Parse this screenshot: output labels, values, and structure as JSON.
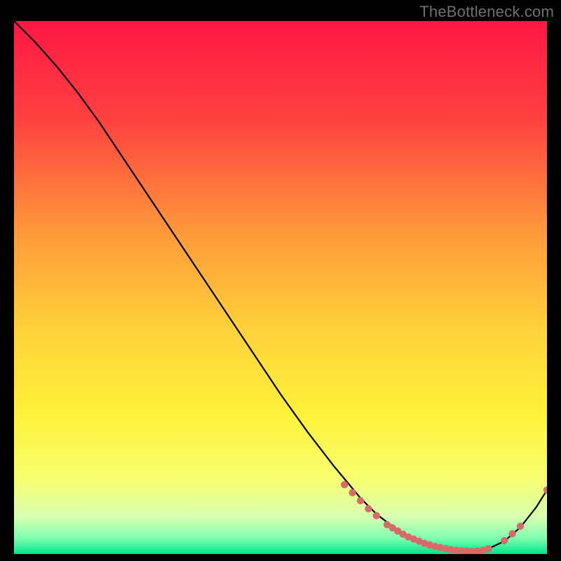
{
  "watermark": "TheBottleneck.com",
  "colors": {
    "curve": "#000000",
    "point_fill": "#d86a6a",
    "gradient_stops": [
      {
        "offset": "0%",
        "color": "#ff1744"
      },
      {
        "offset": "18%",
        "color": "#ff4040"
      },
      {
        "offset": "40%",
        "color": "#ff9a3a"
      },
      {
        "offset": "58%",
        "color": "#ffd23a"
      },
      {
        "offset": "74%",
        "color": "#fff23a"
      },
      {
        "offset": "86%",
        "color": "#f7ff70"
      },
      {
        "offset": "93%",
        "color": "#d8ffb0"
      },
      {
        "offset": "97%",
        "color": "#80ffb0"
      },
      {
        "offset": "100%",
        "color": "#00e58a"
      }
    ]
  },
  "chart_data": {
    "type": "line",
    "title": "",
    "xlabel": "",
    "ylabel": "",
    "xlim": [
      0,
      100
    ],
    "ylim": [
      0,
      100
    ],
    "series": [
      {
        "name": "bottleneck-curve",
        "x": [
          0,
          4,
          8,
          12,
          16,
          20,
          25,
          30,
          35,
          40,
          45,
          50,
          55,
          60,
          65,
          68,
          71,
          74,
          77,
          80,
          83,
          86,
          89,
          92,
          95,
          98,
          100
        ],
        "y": [
          100,
          96,
          91.5,
          86.5,
          81,
          75,
          67.5,
          60,
          52.5,
          45,
          37.5,
          30,
          23,
          16.5,
          10.5,
          7.5,
          5.2,
          3.4,
          2.0,
          1.1,
          0.6,
          0.5,
          1.0,
          2.4,
          5.0,
          8.8,
          12.0
        ]
      }
    ],
    "points": [
      {
        "x": 62,
        "y": 13.0
      },
      {
        "x": 63.5,
        "y": 11.5
      },
      {
        "x": 65,
        "y": 10.0
      },
      {
        "x": 66.5,
        "y": 8.5
      },
      {
        "x": 68,
        "y": 7.2
      },
      {
        "x": 70,
        "y": 5.5
      },
      {
        "x": 71,
        "y": 4.9
      },
      {
        "x": 72,
        "y": 4.3
      },
      {
        "x": 73,
        "y": 3.7
      },
      {
        "x": 74,
        "y": 3.2
      },
      {
        "x": 75,
        "y": 2.8
      },
      {
        "x": 76,
        "y": 2.4
      },
      {
        "x": 77,
        "y": 2.0
      },
      {
        "x": 78,
        "y": 1.7
      },
      {
        "x": 79,
        "y": 1.4
      },
      {
        "x": 80,
        "y": 1.2
      },
      {
        "x": 81,
        "y": 1.0
      },
      {
        "x": 82,
        "y": 0.8
      },
      {
        "x": 83,
        "y": 0.7
      },
      {
        "x": 84,
        "y": 0.6
      },
      {
        "x": 85,
        "y": 0.55
      },
      {
        "x": 86,
        "y": 0.5
      },
      {
        "x": 87,
        "y": 0.55
      },
      {
        "x": 88,
        "y": 0.7
      },
      {
        "x": 89,
        "y": 1.0
      },
      {
        "x": 92,
        "y": 2.5
      },
      {
        "x": 93.5,
        "y": 3.8
      },
      {
        "x": 95,
        "y": 5.2
      },
      {
        "x": 100,
        "y": 12.0
      }
    ]
  }
}
